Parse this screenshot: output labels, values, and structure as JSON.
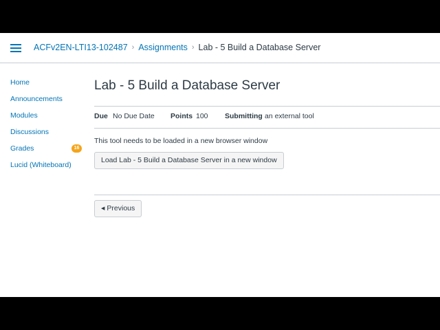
{
  "breadcrumb": {
    "course": "ACFv2EN-LTI13-102487",
    "section": "Assignments",
    "current": "Lab - 5 Build a Database Server"
  },
  "sidebar": {
    "items": [
      {
        "label": "Home"
      },
      {
        "label": "Announcements"
      },
      {
        "label": "Modules"
      },
      {
        "label": "Discussions"
      },
      {
        "label": "Grades",
        "badge": "16"
      },
      {
        "label": "Lucid (Whiteboard)"
      }
    ]
  },
  "assignment": {
    "title": "Lab - 5 Build a Database Server",
    "due_label": "Due",
    "due_value": "No Due Date",
    "points_label": "Points",
    "points_value": "100",
    "submitting_label": "Submitting",
    "submitting_value": "an external tool",
    "notice": "This tool needs to be loaded in a new browser window",
    "load_button": "Load Lab - 5 Build a Database Server in a new window"
  },
  "footer_nav": {
    "previous_label": "Previous"
  },
  "colors": {
    "link": "#0374b5",
    "text": "#2d3b45",
    "badge": "#f5a41b",
    "border": "#c7cdd1"
  }
}
